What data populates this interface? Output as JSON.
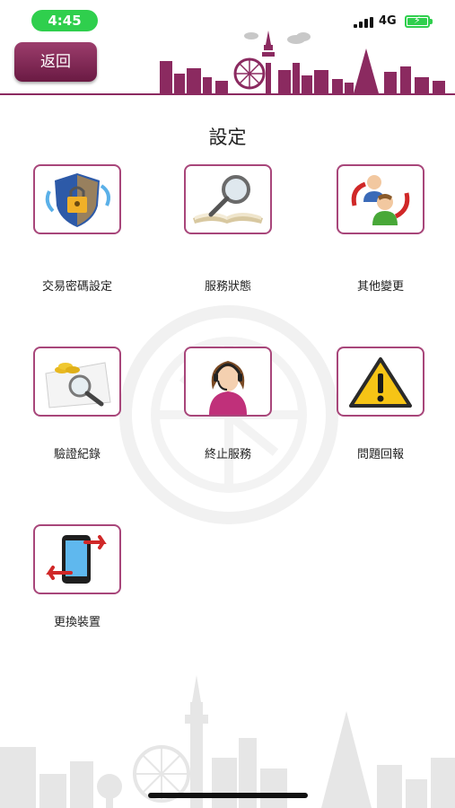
{
  "status_bar": {
    "time": "4:45",
    "network": "4G"
  },
  "header": {
    "back_label": "返回"
  },
  "page": {
    "title": "設定"
  },
  "menu": [
    {
      "label": "交易密碼設定",
      "icon": "lock-shield-icon"
    },
    {
      "label": "服務狀態",
      "icon": "magnifier-book-icon"
    },
    {
      "label": "其他變更",
      "icon": "people-exchange-icon"
    },
    {
      "label": "驗證紀錄",
      "icon": "coins-magnifier-icon"
    },
    {
      "label": "終止服務",
      "icon": "headset-agent-icon"
    },
    {
      "label": "問題回報",
      "icon": "warning-icon"
    },
    {
      "label": "更換裝置",
      "icon": "phone-swap-icon"
    }
  ],
  "colors": {
    "accent": "#8b2a60",
    "status_green": "#2fcf4d",
    "tile_border": "#a8467a"
  }
}
